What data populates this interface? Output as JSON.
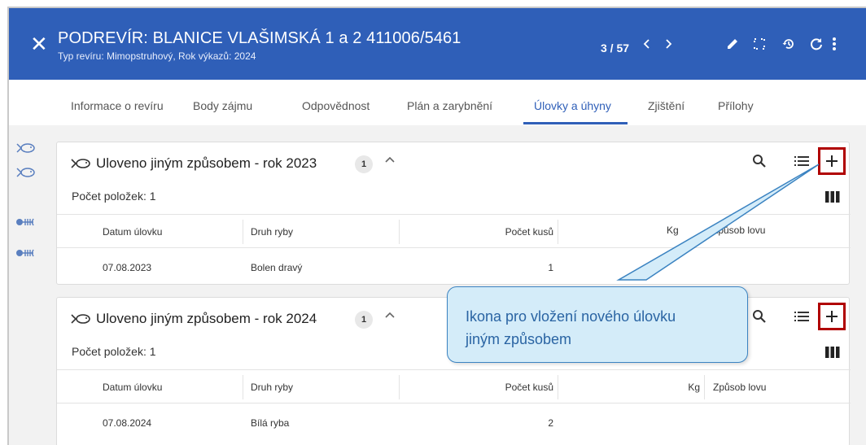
{
  "header": {
    "title": "PODREVÍR: BLANICE VLAŠIMSKÁ 1 a 2 411006/5461",
    "subtitle": "Typ revíru: Mimopstruhový, Rok výkazů: 2024",
    "counter": "3 / 57",
    "bg_color": "#2f5fb8"
  },
  "tabs": [
    {
      "label": "Informace o revíru"
    },
    {
      "label": "Body zájmu"
    },
    {
      "label": "Odpovědnost"
    },
    {
      "label": "Plán a zarybnění"
    },
    {
      "label": "Úlovky a úhyny",
      "active": true
    },
    {
      "label": "Zjištění"
    },
    {
      "label": "Přílohy"
    }
  ],
  "sidebar_icons": [
    "fish-icon",
    "fish-icon",
    "fish-skeleton-icon",
    "fish-skeleton-icon"
  ],
  "sections": [
    {
      "title": "Uloveno jiným způsobem - rok 2023",
      "badge": "1",
      "count_label": "Počet položek: 1",
      "columns": [
        "Datum úlovku",
        "Druh ryby",
        "Počet kusů",
        "Kg",
        "Způsob lovu"
      ],
      "rows": [
        {
          "date": "07.08.2023",
          "fish": "Bolen dravý",
          "count": "1",
          "kg": "",
          "method": ""
        }
      ]
    },
    {
      "title": "Uloveno jiným způsobem - rok 2024",
      "badge": "1",
      "count_label": "Počet položek: 1",
      "columns": [
        "Datum úlovku",
        "Druh ryby",
        "Počet kusů",
        "Kg",
        "Způsob lovu"
      ],
      "rows": [
        {
          "date": "07.08.2024",
          "fish": "Bílá ryba",
          "count": "2",
          "kg": "",
          "method": ""
        }
      ]
    }
  ],
  "callout": {
    "text_line1": "Ikona pro vložení nového úlovku",
    "text_line2": "jiným způsobem"
  },
  "colors": {
    "accent": "#2f5fb8",
    "highlight_border": "#b00000",
    "callout_bg": "#d4ecf9"
  }
}
